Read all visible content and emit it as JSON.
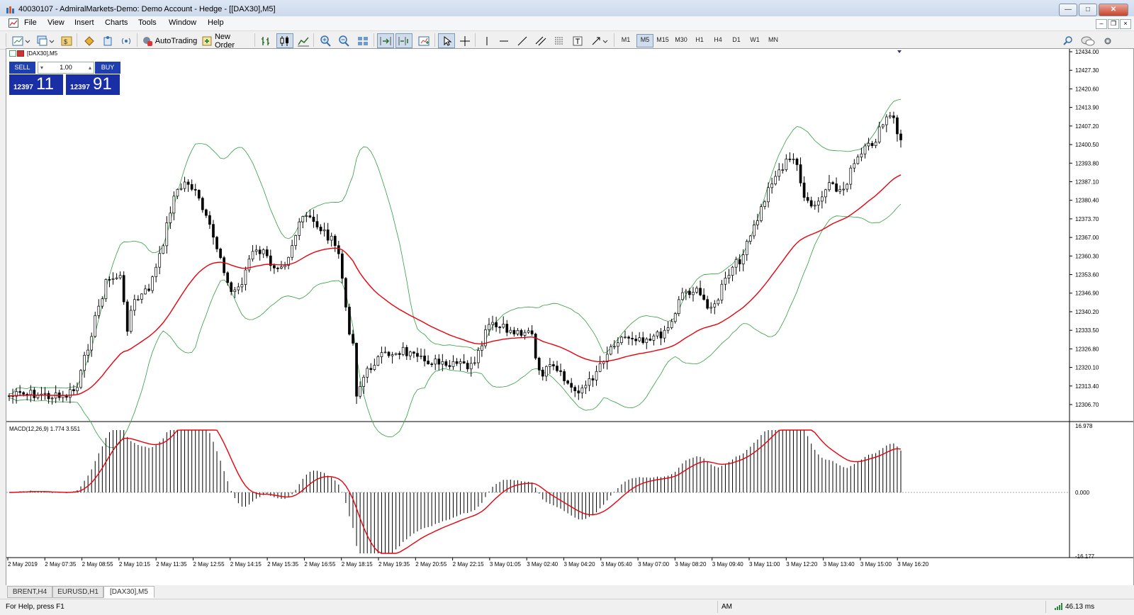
{
  "window": {
    "title": "40030107 - AdmiralMarkets-Demo: Demo Account - Hedge - [[DAX30],M5]"
  },
  "menu": [
    "File",
    "View",
    "Insert",
    "Charts",
    "Tools",
    "Window",
    "Help"
  ],
  "toolbar": {
    "autotrading_label": "AutoTrading",
    "new_order_label": "New Order",
    "timeframes": [
      "M1",
      "M5",
      "M15",
      "M30",
      "H1",
      "H4",
      "D1",
      "W1",
      "MN"
    ],
    "active_timeframe": "M5"
  },
  "chart": {
    "label": "[DAX30],M5",
    "one_click": {
      "sell_label": "SELL",
      "buy_label": "BUY",
      "lot": "1.00",
      "sell_price_prefix": "12397",
      "sell_price_pips": "11",
      "buy_price_prefix": "12397",
      "buy_price_pips": "91"
    },
    "price_axis": [
      "12434.00",
      "12427.30",
      "12420.60",
      "12413.90",
      "12407.20",
      "12400.50",
      "12393.80",
      "12387.10",
      "12380.40",
      "12373.70",
      "12367.00",
      "12360.30",
      "12353.60",
      "12346.90",
      "12340.20",
      "12333.50",
      "12326.80",
      "12320.10",
      "12313.40",
      "12306.70"
    ],
    "macd_label": "MACD(12,26,9) 1.774 3.551",
    "macd_axis": [
      "16.978",
      "0.000",
      "-16.177"
    ],
    "time_axis": [
      "2 May 2019",
      "2 May 07:35",
      "2 May 08:55",
      "2 May 10:15",
      "2 May 11:35",
      "2 May 12:55",
      "2 May 14:15",
      "2 May 15:35",
      "2 May 16:55",
      "2 May 18:15",
      "2 May 19:35",
      "2 May 20:55",
      "2 May 22:15",
      "3 May 01:05",
      "3 May 02:40",
      "3 May 04:20",
      "3 May 05:40",
      "3 May 07:00",
      "3 May 08:20",
      "3 May 09:40",
      "3 May 11:00",
      "3 May 12:20",
      "3 May 13:40",
      "3 May 15:00",
      "3 May 16:20"
    ],
    "colors": {
      "ma": "#e8000b",
      "bands": "#2e9e3e",
      "bars": "#000000",
      "signal": "#e8000b"
    }
  },
  "tabs": [
    "BRENT,H4",
    "EURUSD,H1",
    "[DAX30],M5"
  ],
  "active_tab": "[DAX30],M5",
  "status": {
    "help": "For Help, press F1",
    "profile": "AM",
    "ping": "46.13 ms"
  }
}
